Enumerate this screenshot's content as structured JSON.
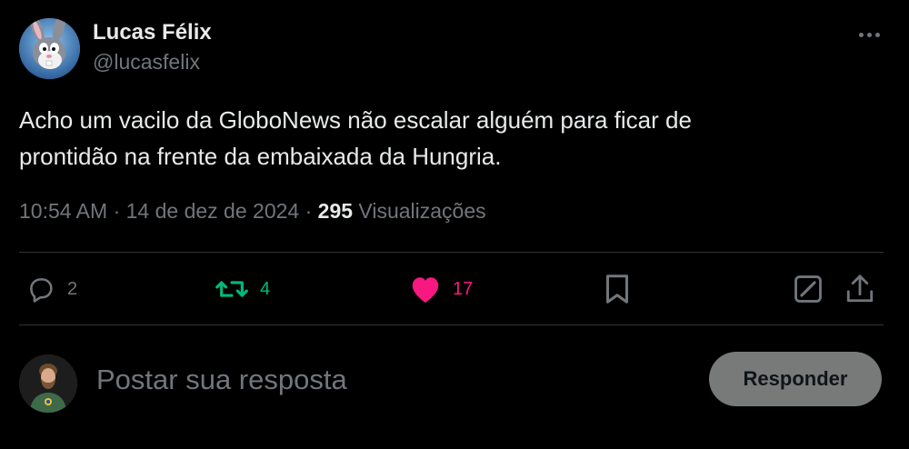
{
  "author": {
    "display_name": "Lucas Félix",
    "handle": "@lucasfelix",
    "avatar_icon": "bugs-bunny-avatar"
  },
  "tweet": {
    "text_line1": "Acho um vacilo da GloboNews não escalar alguém para ficar de",
    "text_line2": "prontidão na frente da embaixada da Hungria.",
    "time": "10:54 AM",
    "separator": "·",
    "date": "14 de dez de 2024",
    "views_count": "295",
    "views_label": "Visualizações"
  },
  "actions": {
    "replies": "2",
    "retweets": "4",
    "likes": "17",
    "reply_icon": "speech-bubble-icon",
    "retweet_icon": "retweet-icon",
    "like_icon": "heart-icon",
    "bookmark_icon": "bookmark-icon",
    "edit_icon": "edit-icon",
    "share_icon": "share-icon"
  },
  "composer": {
    "placeholder": "Postar sua resposta",
    "button_label": "Responder"
  },
  "colors": {
    "background": "#000000",
    "text": "#e7e9ea",
    "muted": "#71767b",
    "retweet": "#00ba7c",
    "like": "#f91880",
    "divider": "#2f3336",
    "button_bg": "#787a7a"
  }
}
